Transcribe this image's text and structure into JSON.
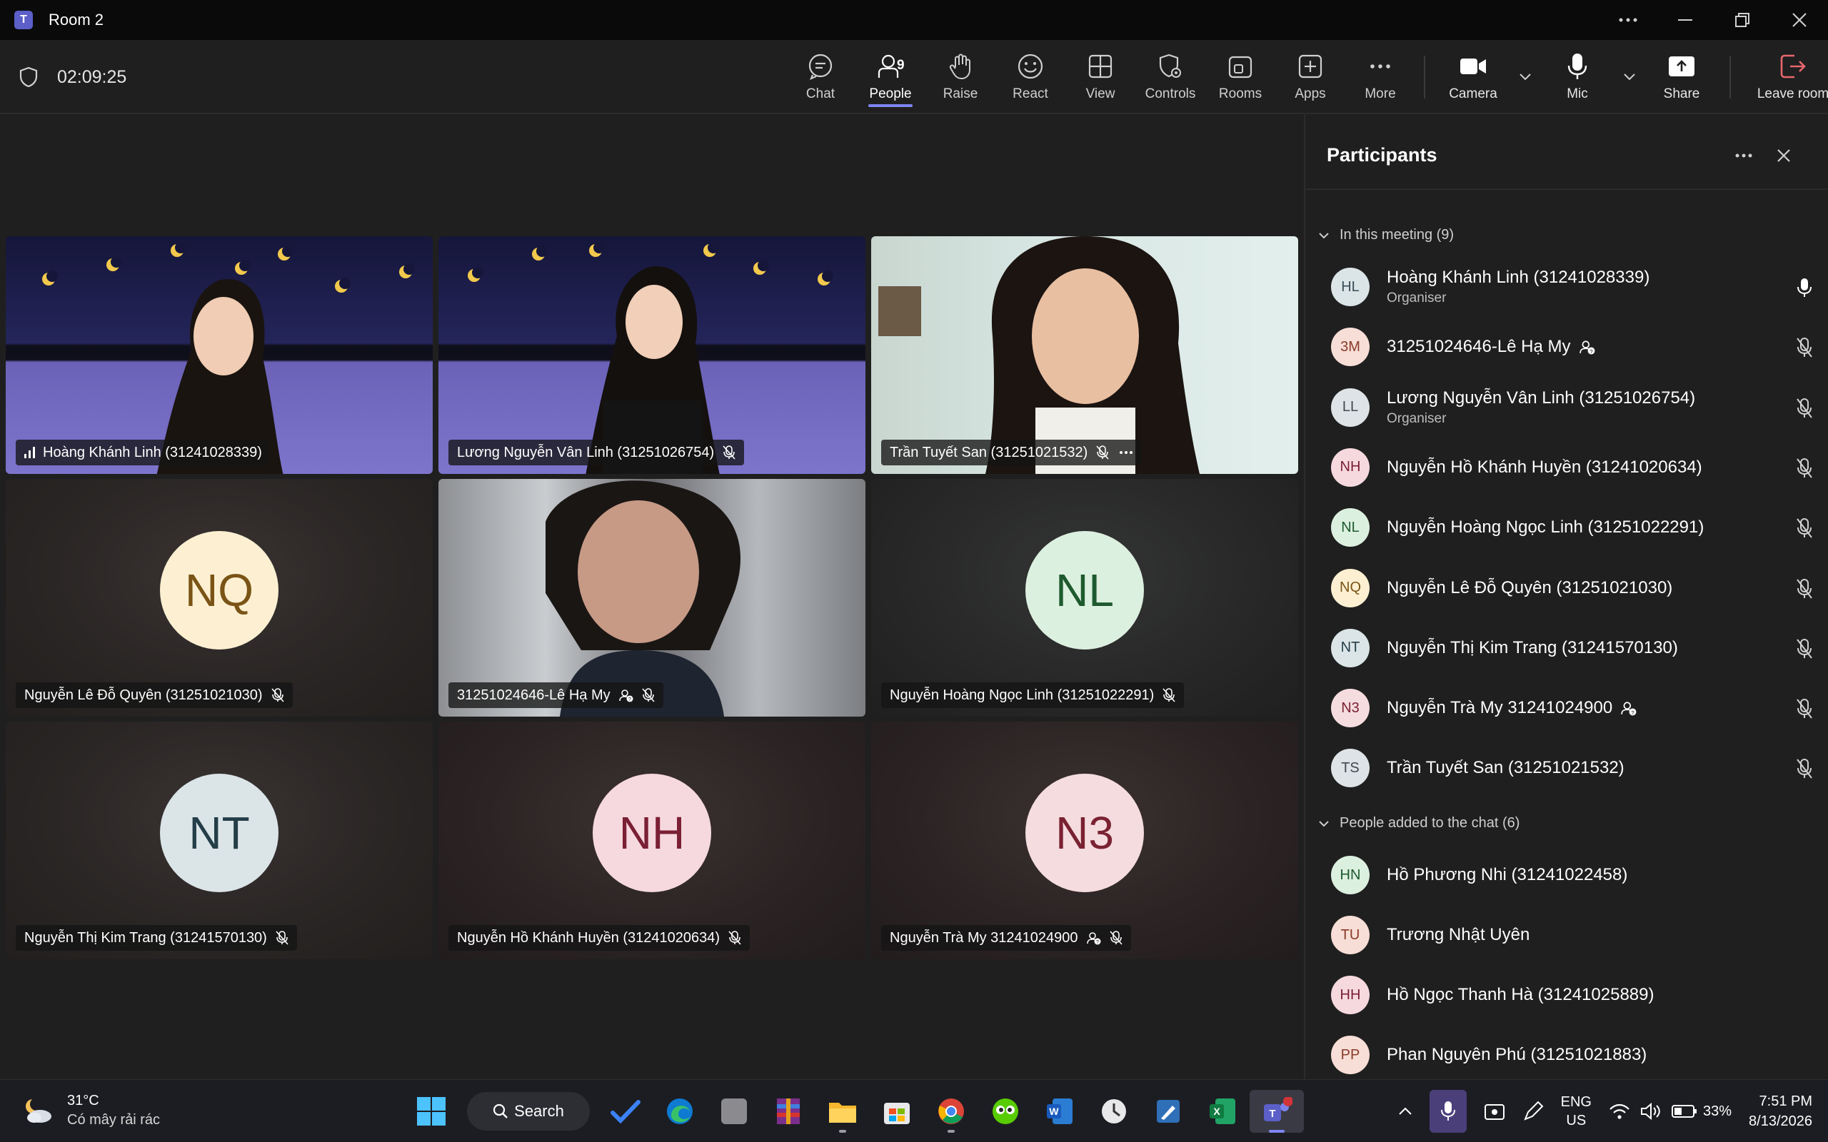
{
  "window": {
    "title": "Room 2",
    "controls": [
      "more",
      "minimize",
      "restore",
      "close"
    ]
  },
  "toolbar": {
    "timer": "02:09:25",
    "people_count": "9",
    "buttons": {
      "chat": "Chat",
      "people": "People",
      "raise": "Raise",
      "react": "React",
      "view": "View",
      "controls": "Controls",
      "rooms": "Rooms",
      "apps": "Apps",
      "more": "More",
      "camera": "Camera",
      "mic": "Mic",
      "share": "Share",
      "leave": "Leave room"
    },
    "leave_color": "#e8676e",
    "active_tab": "People"
  },
  "tiles": [
    {
      "name": "Hoàng Khánh Linh (31241028339)",
      "video": "night",
      "signal": true,
      "muted": false
    },
    {
      "name": "Lương Nguyễn Vân Linh (31251026754)",
      "video": "night",
      "muted": true
    },
    {
      "name": "Trần Tuyết San (31251021532)",
      "video": "room",
      "muted": true,
      "more": true
    },
    {
      "name": "Nguyễn Lê Đỗ Quyên (31251021030)",
      "initials": "NQ",
      "avatar_bg": "#fdf0d2",
      "avatar_fg": "#7a5416",
      "muted": true
    },
    {
      "name": "31251024646-Lê Hạ My",
      "video": "street",
      "guest": true,
      "muted": true
    },
    {
      "name": "Nguyễn Hoàng Ngọc Linh (31251022291)",
      "initials": "NL",
      "avatar_bg": "#dcf0e0",
      "avatar_fg": "#1e5a2e",
      "muted": true
    },
    {
      "name": "Nguyễn Thị Kim Trang (31241570130)",
      "initials": "NT",
      "avatar_bg": "#dbe5e8",
      "avatar_fg": "#243e48",
      "muted": true
    },
    {
      "name": "Nguyễn Hồ Khánh Huyền (31241020634)",
      "initials": "NH",
      "avatar_bg": "#f6d9df",
      "avatar_fg": "#7a1f34",
      "muted": true
    },
    {
      "name": "Nguyễn Trà My 31241024900",
      "initials": "N3",
      "avatar_bg": "#f5dcdf",
      "avatar_fg": "#7a2232",
      "guest": true,
      "muted": true
    }
  ],
  "panel": {
    "title": "Participants",
    "in_meeting_label": "In this meeting (9)",
    "in_meeting": [
      {
        "initials": "HL",
        "name": "Hoàng Khánh Linh (31241028339)",
        "role": "Organiser",
        "bg": "#dbe5e8",
        "fg": "#3a4d55",
        "mic": "on"
      },
      {
        "initials": "3M",
        "name": "31251024646-Lê Hạ My",
        "bg": "#f7ded6",
        "fg": "#8a3b2a",
        "guest": true,
        "mic": "off"
      },
      {
        "initials": "LL",
        "name": "Lương Nguyễn Vân Linh (31251026754)",
        "role": "Organiser",
        "bg": "#dde3e6",
        "fg": "#3f4a50",
        "mic": "off"
      },
      {
        "initials": "NH",
        "name": "Nguyễn Hồ Khánh Huyền (31241020634)",
        "bg": "#f6d9df",
        "fg": "#7a1f34",
        "mic": "off"
      },
      {
        "initials": "NL",
        "name": "Nguyễn Hoàng Ngọc Linh (31251022291)",
        "bg": "#dcf0e0",
        "fg": "#1e5a2e",
        "mic": "off"
      },
      {
        "initials": "NQ",
        "name": "Nguyễn Lê Đỗ Quyên (31251021030)",
        "bg": "#fdf0d2",
        "fg": "#7a5416",
        "mic": "off"
      },
      {
        "initials": "NT",
        "name": "Nguyễn Thị Kim Trang (31241570130)",
        "bg": "#dbe5e8",
        "fg": "#243e48",
        "mic": "off"
      },
      {
        "initials": "N3",
        "name": "Nguyễn Trà My 31241024900",
        "bg": "#f5dcdf",
        "fg": "#7a2232",
        "guest": true,
        "mic": "off"
      },
      {
        "initials": "TS",
        "name": "Trần Tuyết San (31251021532)",
        "bg": "#dde3e6",
        "fg": "#3f4a50",
        "mic": "off"
      }
    ],
    "added_label": "People added to the chat (6)",
    "added": [
      {
        "initials": "HN",
        "name": "Hồ Phương Nhi (31241022458)",
        "bg": "#dcf0e0",
        "fg": "#1e5a2e",
        "status": "#d13438"
      },
      {
        "initials": "TU",
        "name": "Trương Nhật Uyên",
        "bg": "#f7ded6",
        "fg": "#8a3b2a",
        "status": "#8a8a8a"
      },
      {
        "initials": "HH",
        "name": "Hồ Ngọc Thanh Hà (31241025889)",
        "bg": "#f6d9df",
        "fg": "#7a1f34",
        "status": "#6bb700"
      },
      {
        "initials": "PP",
        "name": "Phan Nguyên Phú (31251021883)",
        "bg": "#f7ded6",
        "fg": "#8a3b2a",
        "status": "#d13438"
      }
    ]
  },
  "taskbar": {
    "weather_temp": "31°C",
    "weather_desc": "Có mây rải rác",
    "search_label": "Search",
    "apps": [
      "windows-start",
      "search",
      "todo",
      "edge",
      "blank-app",
      "winrar",
      "file-explorer",
      "microsoft-store",
      "chrome",
      "duolingo",
      "word",
      "clock",
      "drawing-app",
      "excel",
      "teams"
    ],
    "lang_1": "ENG",
    "lang_2": "US",
    "battery": "33%",
    "time": "7:51 PM",
    "date": "8/13/2026"
  }
}
